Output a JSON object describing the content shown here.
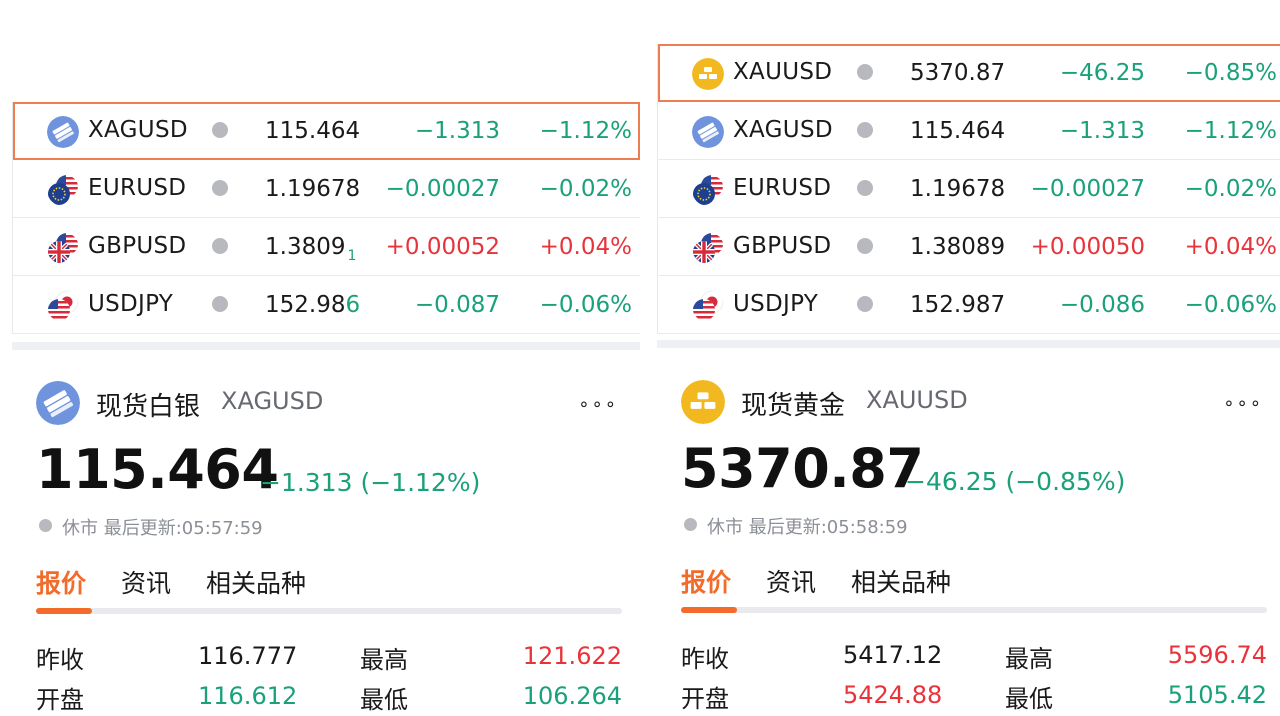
{
  "left": {
    "quotes": [
      {
        "symbol": "XAGUSD",
        "price": "115.464",
        "price_tail": "",
        "tick": "",
        "change": "−1.313",
        "pct": "−1.12%",
        "dir": "down",
        "icon": "silver-bars-icon",
        "selected": true
      },
      {
        "symbol": "EURUSD",
        "price": "1.19678",
        "price_tail": "",
        "tick": "",
        "change": "−0.00027",
        "pct": "−0.02%",
        "dir": "down",
        "icon": "eu-us-flag-icon",
        "selected": false
      },
      {
        "symbol": "GBPUSD",
        "price": "1.3809",
        "price_tail": "",
        "tick": "1",
        "change": "+0.00052",
        "pct": "+0.04%",
        "dir": "up",
        "icon": "uk-us-flag-icon",
        "selected": false
      },
      {
        "symbol": "USDJPY",
        "price": "152.98",
        "price_tail": "6",
        "tick": "",
        "change": "−0.087",
        "pct": "−0.06%",
        "dir": "down",
        "icon": "us-jp-flag-icon",
        "selected": false
      }
    ],
    "detail": {
      "name": "现货白银",
      "code": "XAGUSD",
      "more": "∘∘∘",
      "price": "115.464",
      "change": "−1.313 (−1.12%)",
      "status": "休市  最后更新:05:57:59",
      "tabs": [
        "报价",
        "资讯",
        "相关品种"
      ],
      "stats": {
        "prev_close_label": "昨收",
        "prev_close": "116.777",
        "high_label": "最高",
        "high": "121.622",
        "open_label": "开盘",
        "open": "116.612",
        "low_label": "最低",
        "low": "106.264"
      }
    }
  },
  "right": {
    "quotes": [
      {
        "symbol": "XAUUSD",
        "price": "5370.87",
        "price_tail": "",
        "tick": "",
        "change": "−46.25",
        "pct": "−0.85%",
        "dir": "down",
        "icon": "gold-bars-icon",
        "selected": true
      },
      {
        "symbol": "XAGUSD",
        "price": "115.464",
        "price_tail": "",
        "tick": "",
        "change": "−1.313",
        "pct": "−1.12%",
        "dir": "down",
        "icon": "silver-bars-icon",
        "selected": false
      },
      {
        "symbol": "EURUSD",
        "price": "1.19678",
        "price_tail": "",
        "tick": "",
        "change": "−0.00027",
        "pct": "−0.02%",
        "dir": "down",
        "icon": "eu-us-flag-icon",
        "selected": false
      },
      {
        "symbol": "GBPUSD",
        "price": "1.38089",
        "price_tail": "",
        "tick": "",
        "change": "+0.00050",
        "pct": "+0.04%",
        "dir": "up",
        "icon": "uk-us-flag-icon",
        "selected": false
      },
      {
        "symbol": "USDJPY",
        "price": "152.987",
        "price_tail": "",
        "tick": "",
        "change": "−0.086",
        "pct": "−0.06%",
        "dir": "down",
        "icon": "us-jp-flag-icon",
        "selected": false
      }
    ],
    "detail": {
      "name": "现货黄金",
      "code": "XAUUSD",
      "more": "∘∘∘",
      "price": "5370.87",
      "change": "−46.25 (−0.85%)",
      "status": "休市  最后更新:05:58:59",
      "tabs": [
        "报价",
        "资讯",
        "相关品种"
      ],
      "stats": {
        "prev_close_label": "昨收",
        "prev_close": "5417.12",
        "high_label": "最高",
        "high": "5596.74",
        "open_label": "开盘",
        "open": "5424.88",
        "low_label": "最低",
        "low": "5105.42"
      }
    }
  },
  "colors": {
    "up": "#e8333b",
    "down": "#1aa17a",
    "accent": "#f26b2a",
    "selected_border": "#ee7d4f",
    "gold": "#f2b81f",
    "silver": "#6f93dc"
  }
}
